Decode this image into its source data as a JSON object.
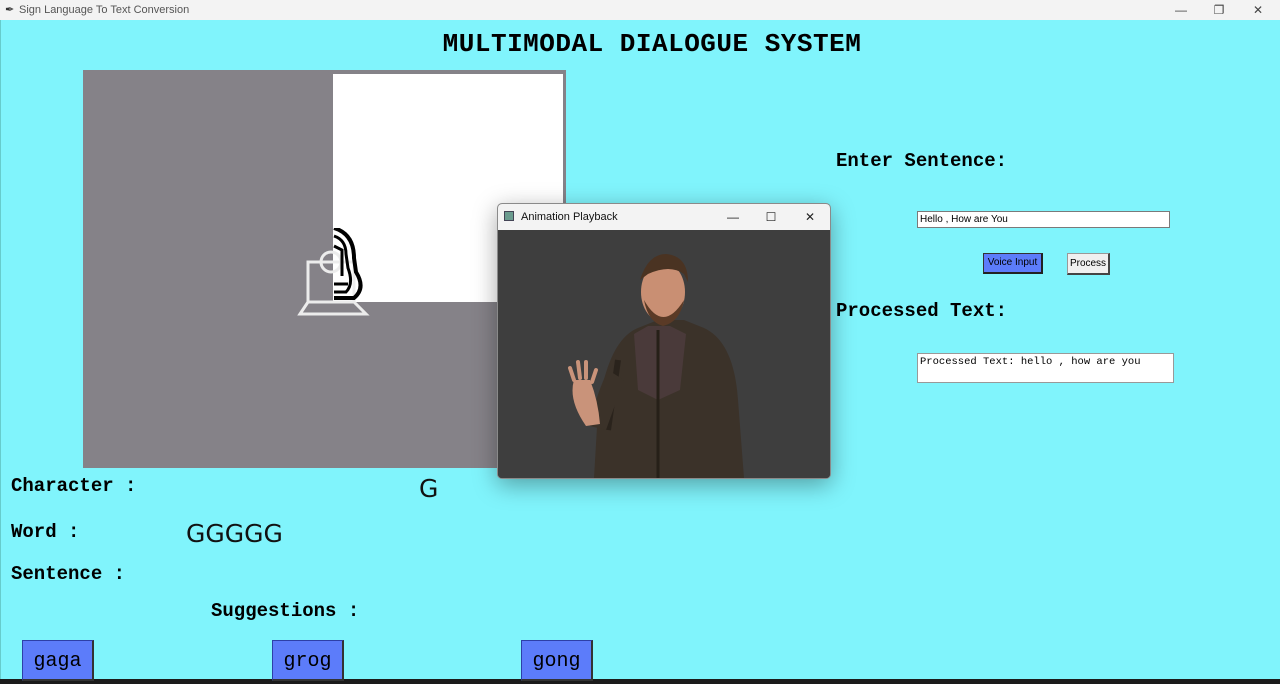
{
  "window": {
    "title": "Sign Language To Text Conversion",
    "minimize": "—",
    "restore": "❐",
    "close": "✕"
  },
  "heading": "MULTIMODAL DIALOGUE SYSTEM",
  "labels": {
    "character": "Character :",
    "word": "Word :",
    "sentence": "Sentence :",
    "suggestions": "Suggestions :",
    "enter_sentence": "Enter Sentence:",
    "processed_text": "Processed Text:"
  },
  "values": {
    "character": "G",
    "word": "GGGGG",
    "sentence": ""
  },
  "suggestions": [
    "gaga",
    "grog",
    "gong"
  ],
  "form": {
    "sentence_value": "Hello , How are You",
    "voice_button": "Voice Input",
    "process_button": "Process",
    "processed_output": "Processed Text: hello , how are you"
  },
  "animation_window": {
    "title": "Animation Playback",
    "minimize": "—",
    "maximize": "☐",
    "close": "✕"
  },
  "colors": {
    "background": "#80f4fc",
    "button_blue": "#5c7cfa",
    "camera_gray": "#858288"
  }
}
